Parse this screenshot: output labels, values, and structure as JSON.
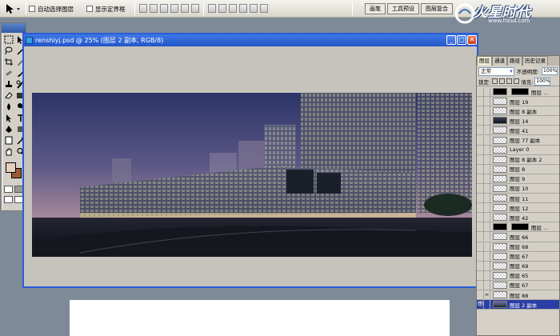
{
  "options_bar": {
    "auto_select_label": "自动选择图层",
    "show_bounds_label": "显示定界框",
    "well_tabs": [
      "画笔",
      "工具预设",
      "图层复合"
    ]
  },
  "logo": {
    "text": "火星时代",
    "url": "www.hxsd.com"
  },
  "toolbox": {
    "icons": [
      "marquee-icon",
      "move-icon",
      "lasso-icon",
      "magic-wand-icon",
      "crop-icon",
      "slice-icon",
      "healing-icon",
      "brush-icon",
      "stamp-icon",
      "history-brush-icon",
      "eraser-icon",
      "gradient-icon",
      "blur-icon",
      "dodge-icon",
      "path-select-icon",
      "type-icon",
      "pen-icon",
      "shape-icon",
      "notes-icon",
      "eyedropper-icon",
      "hand-icon",
      "zoom-icon"
    ],
    "foreground_color": "#e4d0bc",
    "background_color": "#9a5a36"
  },
  "document": {
    "title": "renshiyj.psd @ 25% (图层 2 副本, RGB/8)",
    "minimize_label": "_",
    "maximize_label": "□",
    "close_label": "✕"
  },
  "layers_panel": {
    "tabs": [
      "图层",
      "通道",
      "路径",
      "历史记录"
    ],
    "blend_mode": "正常",
    "opacity_label": "不透明度:",
    "opacity_value": "100%",
    "lock_label": "锁定:",
    "fill_label": "填充:",
    "fill_value": "100%",
    "layers": [
      {
        "name": "图层 ...",
        "thumb": "black",
        "mask": true
      },
      {
        "name": "图层 19",
        "thumb": "checker"
      },
      {
        "name": "图层 8 副本",
        "thumb": "checker"
      },
      {
        "name": "图层 14",
        "thumb": "dark"
      },
      {
        "name": "图层 41",
        "thumb": "checker"
      },
      {
        "name": "图层 77 副本",
        "thumb": "checker"
      },
      {
        "name": "Layer 0",
        "thumb": "checker"
      },
      {
        "name": "图层 8 副本 2",
        "thumb": "checker"
      },
      {
        "name": "图层 8",
        "thumb": "checker"
      },
      {
        "name": "图层 9",
        "thumb": "checker"
      },
      {
        "name": "图层 10",
        "thumb": "checker"
      },
      {
        "name": "图层 11",
        "thumb": "checker"
      },
      {
        "name": "图层 12",
        "thumb": "checker"
      },
      {
        "name": "图层 42",
        "thumb": "checker"
      },
      {
        "name": "图层 ...",
        "thumb": "black",
        "mask": true
      },
      {
        "name": "图层 66",
        "thumb": "checker"
      },
      {
        "name": "图层 68",
        "thumb": "checker"
      },
      {
        "name": "图层 67",
        "thumb": "checker"
      },
      {
        "name": "图层 69",
        "thumb": "checker"
      },
      {
        "name": "图层 65",
        "thumb": "checker"
      },
      {
        "name": "图层 67",
        "thumb": "checker"
      },
      {
        "name": "图层 88",
        "thumb": "checker",
        "linked": true
      },
      {
        "name": "图层 2 副本",
        "thumb": "pic",
        "selected": true
      }
    ]
  }
}
